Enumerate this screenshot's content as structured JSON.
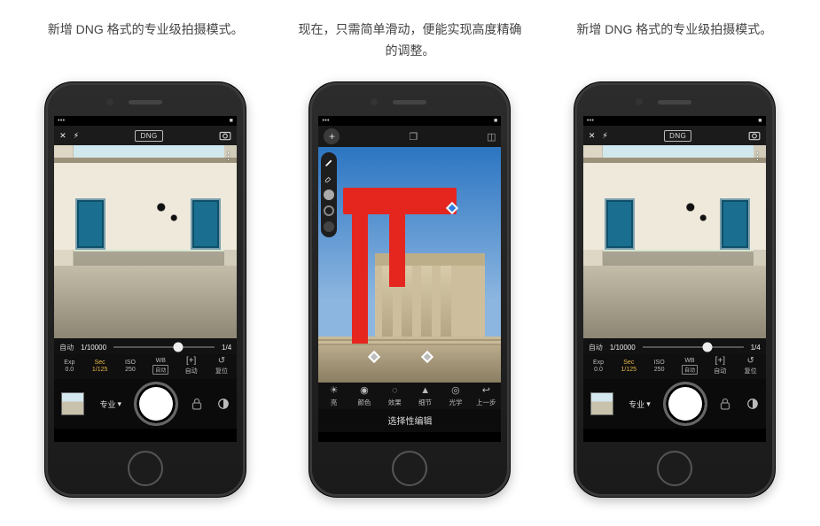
{
  "captions": {
    "left": "新增 DNG 格式的专业级拍摄模式。",
    "middle": "现在，只需简单滑动，便能实现高度精确的调整。",
    "right": "新增 DNG 格式的专业级拍摄模式。"
  },
  "camera_screen": {
    "topbar": {
      "close": "✕",
      "flash": "⚡︎",
      "format_badge": "DNG",
      "switch_cam": "⟲"
    },
    "overflow_dots": "⋮",
    "slider": {
      "left_label": "自动",
      "left_value": "1/10000",
      "right_value": "1/4"
    },
    "params": {
      "exp": {
        "label": "Exp",
        "value": "0.0"
      },
      "sec": {
        "label": "Sec",
        "value": "1/125"
      },
      "iso": {
        "label": "ISO",
        "value": "250"
      },
      "wb": {
        "label": "WB",
        "value": "自动"
      },
      "focus": {
        "label": "[+]",
        "value": "自动"
      },
      "reset": {
        "label": "↺",
        "value": "复位"
      }
    },
    "bottom": {
      "mode_label": "专业",
      "mode_caret": "▾",
      "lock": "🔒",
      "switch": "◐"
    }
  },
  "edit_screen": {
    "topbar": {
      "add": "+",
      "compare": "❐",
      "crop": "◫"
    },
    "tools_rail": [
      "brush",
      "eraser",
      "dot-solid",
      "dot-ring",
      "dot-dark"
    ],
    "tabs": {
      "light": {
        "glyph": "☀",
        "label": "亮"
      },
      "color": {
        "glyph": "◉",
        "label": "颜色"
      },
      "effect": {
        "glyph": "◌",
        "label": "效果"
      },
      "detail": {
        "glyph": "▲",
        "label": "细节"
      },
      "optics": {
        "glyph": "◎",
        "label": "光学"
      },
      "prev": {
        "glyph": "↩",
        "label": "上一步"
      }
    },
    "title": "选择性编辑"
  }
}
